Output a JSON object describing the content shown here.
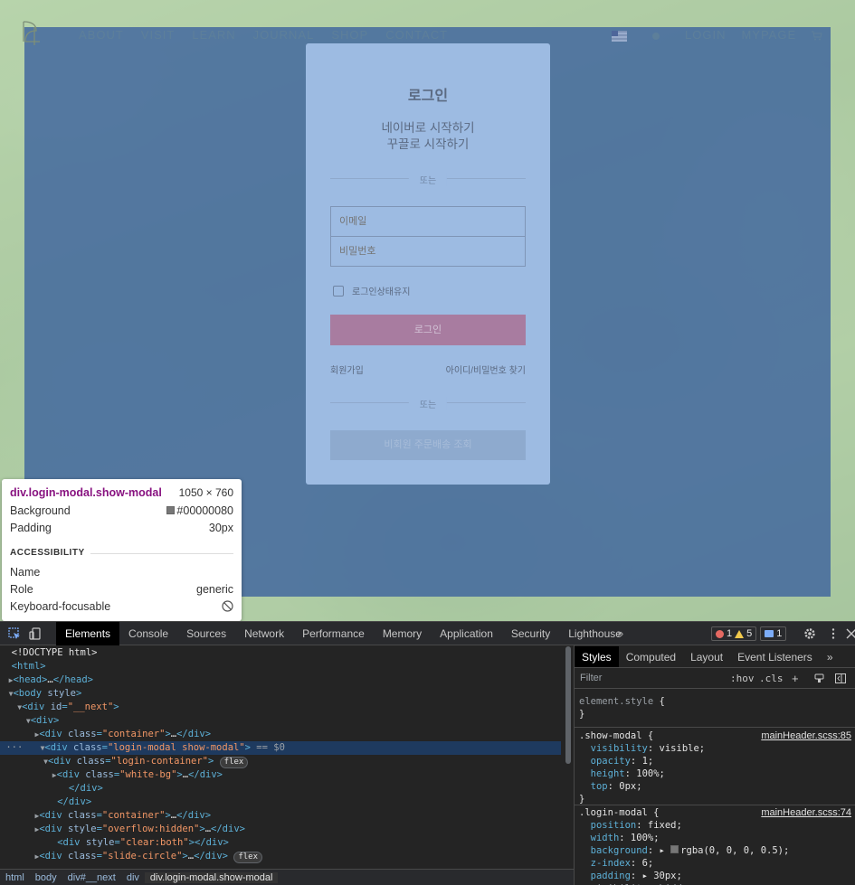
{
  "header": {
    "nav_main": [
      "ABOUT",
      "VISIT",
      "LEARN",
      "JOURNAL",
      "SHOP",
      "CONTACT"
    ],
    "nav_right": [
      "LOGIN",
      "MYPAGE"
    ]
  },
  "login": {
    "title": "로그인",
    "naver": "네이버로 시작하기",
    "google": "꾸끌로 시작하기",
    "divider_1": "또는",
    "email_placeholder": "이메일",
    "password_placeholder": "비밀번호",
    "keep_login": "로그인상태유지",
    "login_button": "로그인",
    "signup": "회원가입",
    "find_account": "아이디/비밀번호 찾기",
    "divider_2": "또는",
    "guest_order": "비회원 주문배송 조회"
  },
  "tooltip": {
    "selector": "div.login-modal.show-modal",
    "size": "1050 × 760",
    "background_label": "Background",
    "background_value": "#00000080",
    "padding_label": "Padding",
    "padding_value": "30px",
    "accessibility": "ACCESSIBILITY",
    "name_label": "Name",
    "role_label": "Role",
    "role_value": "generic",
    "focusable_label": "Keyboard-focusable"
  },
  "devtools": {
    "tabs": [
      "Elements",
      "Console",
      "Sources",
      "Network",
      "Performance",
      "Memory",
      "Application",
      "Security",
      "Lighthouse"
    ],
    "more": "»",
    "errors": "1",
    "warnings": "5",
    "messages": "1",
    "breadcrumbs": [
      "html",
      "body",
      "div#__next",
      "div",
      "div.login-modal.show-modal"
    ],
    "styles_tabs": [
      "Styles",
      "Computed",
      "Layout",
      "Event Listeners",
      "»"
    ],
    "filter_placeholder": "Filter",
    "hov": ":hov",
    "cls": ".cls",
    "add": "+",
    "source_show": "mainHeader.scss:85",
    "source_login": "mainHeader.scss:74"
  },
  "colors": {
    "padding_overlay": "#93c47d",
    "content_overlay": "#3e649e",
    "login_button": "#a87ca0"
  }
}
